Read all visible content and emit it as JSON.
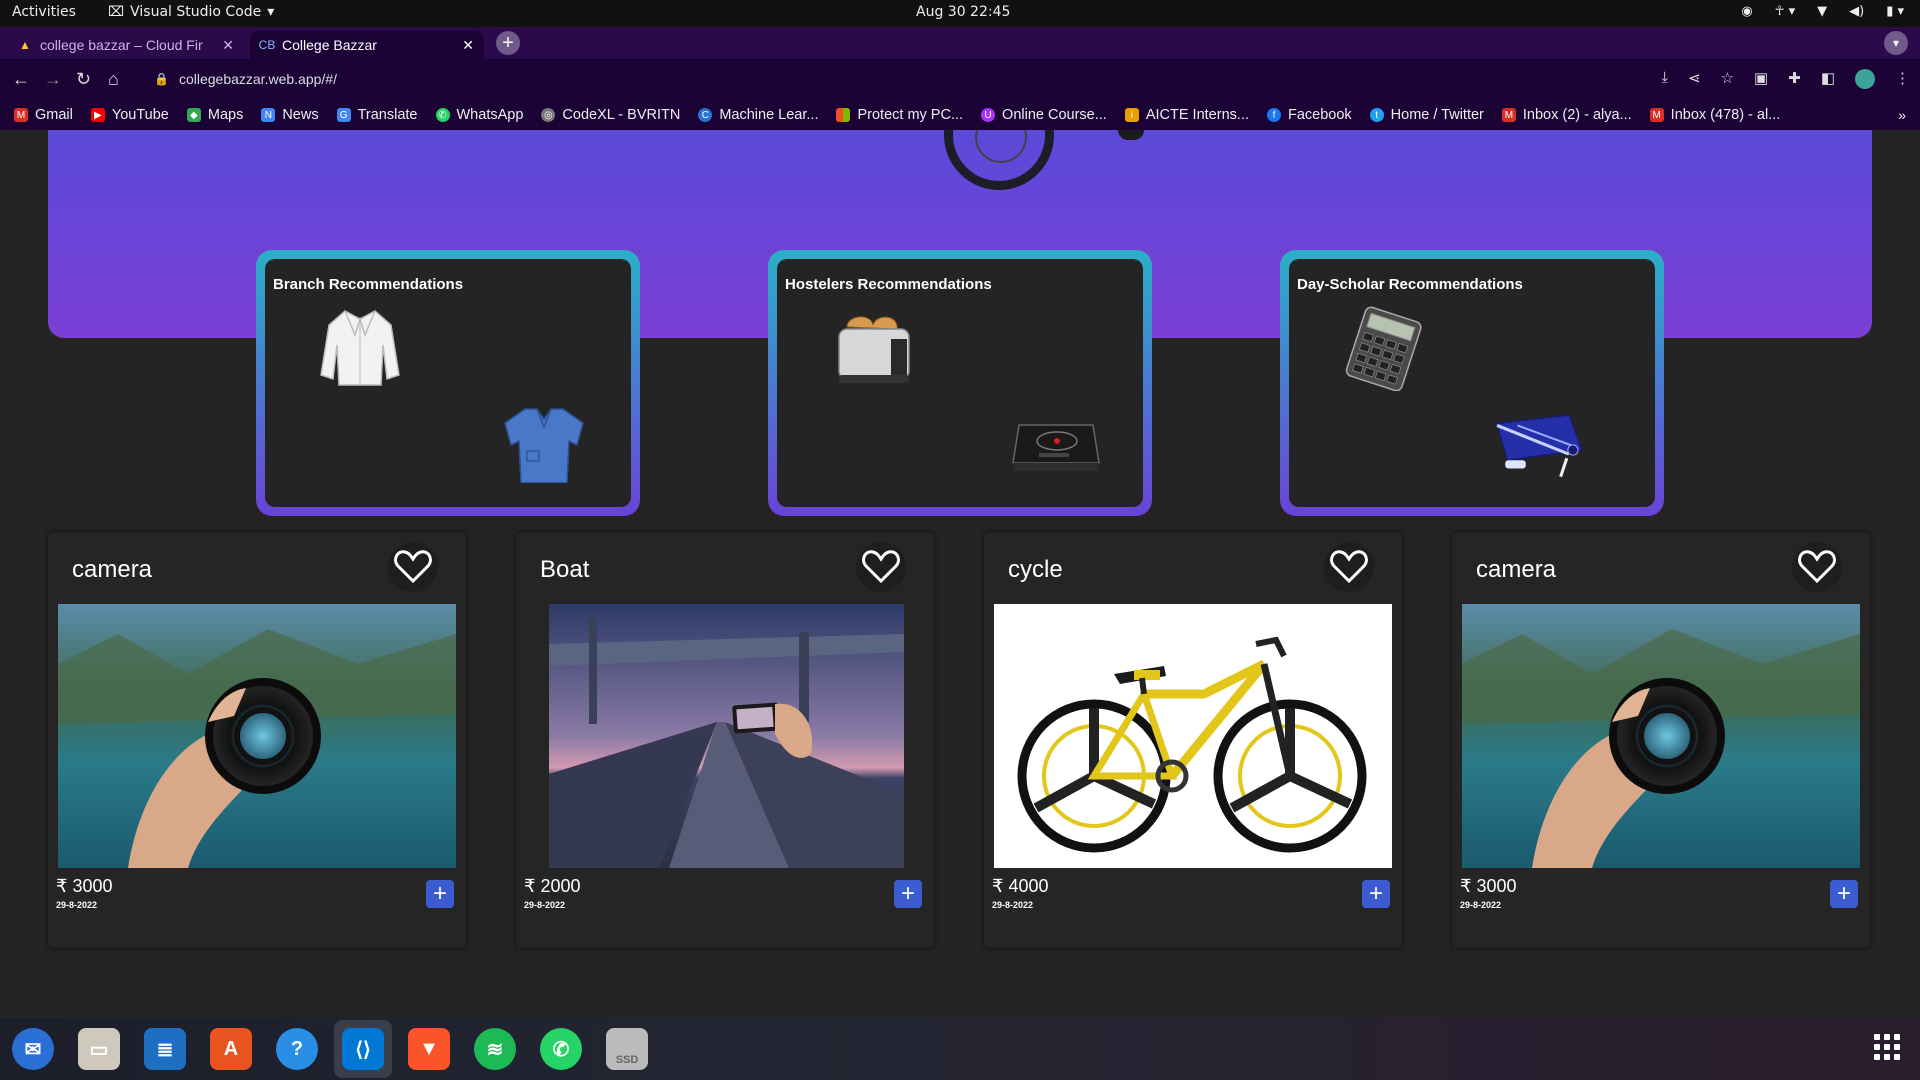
{
  "system_bar": {
    "activities": "Activities",
    "app_name": "Visual Studio Code",
    "datetime": "Aug 30  22:45"
  },
  "browser": {
    "tabs": [
      {
        "title": "college bazzar – Cloud Fir",
        "active": false
      },
      {
        "title": "College Bazzar",
        "active": true
      }
    ],
    "url": "collegebazzar.web.app/#/",
    "bookmarks": [
      {
        "label": "Gmail",
        "icon": "gmail-icon",
        "color": "#d93025"
      },
      {
        "label": "YouTube",
        "icon": "youtube-icon",
        "color": "#ff0000"
      },
      {
        "label": "Maps",
        "icon": "maps-icon",
        "color": "#34a853"
      },
      {
        "label": "News",
        "icon": "news-icon",
        "color": "#4285f4"
      },
      {
        "label": "Translate",
        "icon": "translate-icon",
        "color": "#4285f4"
      },
      {
        "label": "WhatsApp",
        "icon": "whatsapp-icon",
        "color": "#25d366"
      },
      {
        "label": "CodeXL - BVRITN",
        "icon": "globe-icon",
        "color": "#777777"
      },
      {
        "label": "Machine Lear...",
        "icon": "coursera-icon",
        "color": "#2a73cc"
      },
      {
        "label": "Protect my PC...",
        "icon": "microsoft-icon",
        "color": "#f25022"
      },
      {
        "label": "Online Course...",
        "icon": "udemy-icon",
        "color": "#a435f0"
      },
      {
        "label": "AICTE Interns...",
        "icon": "info-icon",
        "color": "#e6a100"
      },
      {
        "label": "Facebook",
        "icon": "facebook-icon",
        "color": "#1877f2"
      },
      {
        "label": "Home / Twitter",
        "icon": "twitter-icon",
        "color": "#1da1f2"
      },
      {
        "label": "Inbox (2) - alya...",
        "icon": "gmail-icon",
        "color": "#d93025"
      },
      {
        "label": "Inbox (478) - al...",
        "icon": "gmail-icon",
        "color": "#d93025"
      }
    ]
  },
  "recommendations": [
    {
      "title": "Branch Recommendations"
    },
    {
      "title": "Hostelers Recommendations"
    },
    {
      "title": "Day-Scholar Recommendations"
    }
  ],
  "products": [
    {
      "name": "camera",
      "price": "₹ 3000",
      "date": "29-8-2022"
    },
    {
      "name": "Boat",
      "price": "₹ 2000",
      "date": "29-8-2022"
    },
    {
      "name": "cycle",
      "price": "₹ 4000",
      "date": "29-8-2022"
    },
    {
      "name": "camera",
      "price": "₹ 3000",
      "date": "29-8-2022"
    }
  ],
  "dock": {
    "apps": [
      "thunderbird-icon",
      "files-icon",
      "writer-icon",
      "software-icon",
      "help-icon",
      "vscode-icon",
      "brave-icon",
      "spotify-icon",
      "whatsapp-icon",
      "ssd-icon"
    ],
    "ssd_label": "SSD"
  },
  "colors": {
    "hero_start": "#5b4ad8",
    "hero_end": "#7b3fd6",
    "card_border_top": "#2bb0c8",
    "card_border_bottom": "#6a44d6",
    "add_button": "#3b5bd0",
    "browser_bg": "#1b0336"
  }
}
